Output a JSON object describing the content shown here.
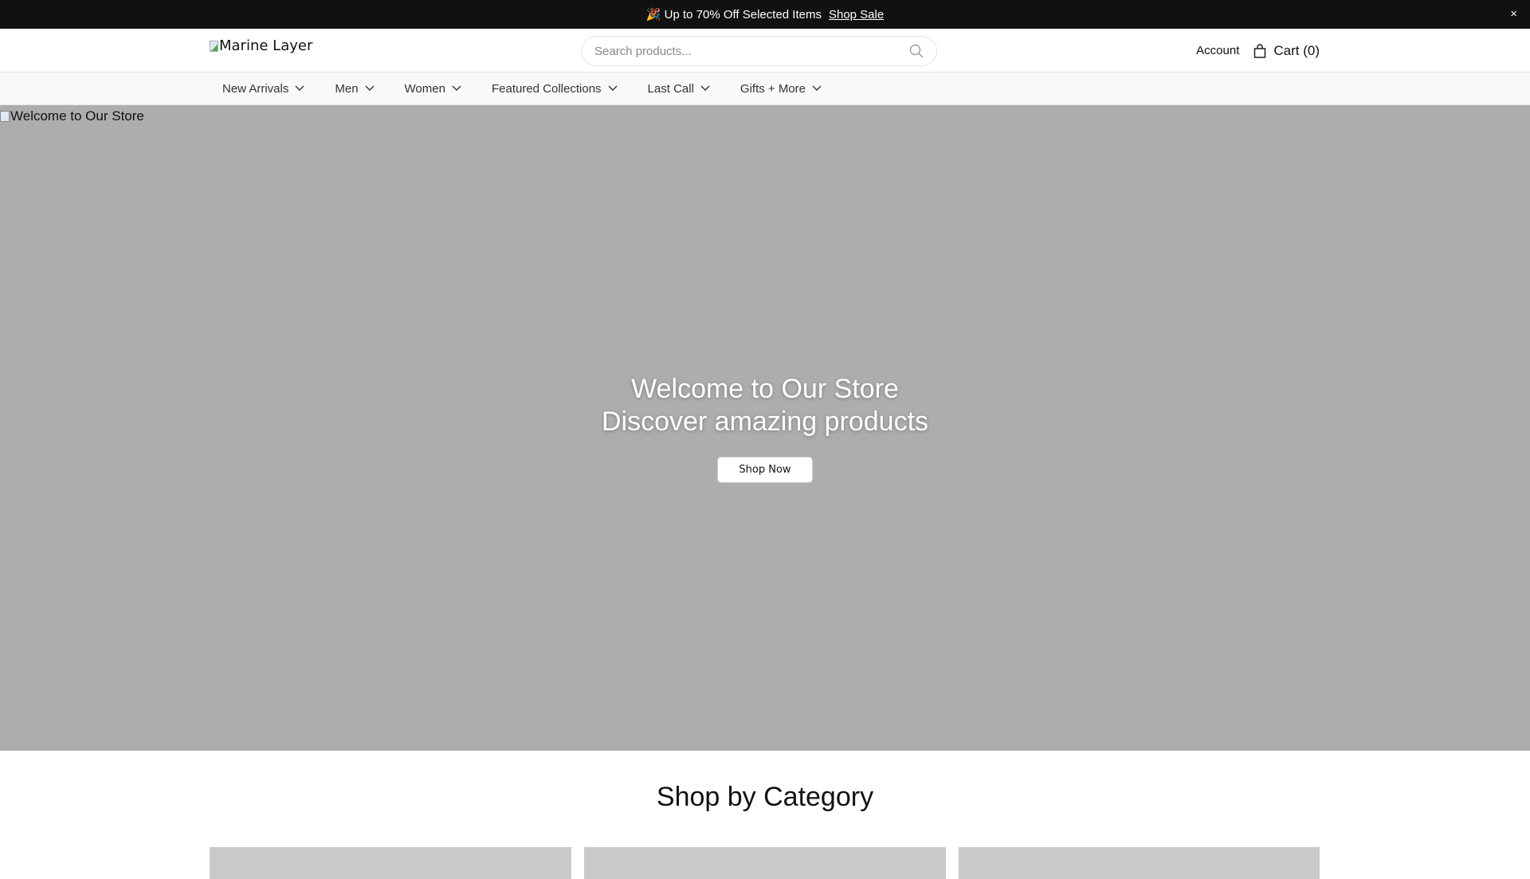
{
  "announcement": {
    "emoji": "🎉",
    "text": "Up to 70% Off Selected Items",
    "link": "Shop Sale",
    "close": "×"
  },
  "header": {
    "logo_alt": "Marine Layer",
    "search_placeholder": "Search products...",
    "account": "Account",
    "cart": "Cart (0)"
  },
  "nav": {
    "items": [
      {
        "label": "New Arrivals"
      },
      {
        "label": "Men"
      },
      {
        "label": "Women"
      },
      {
        "label": "Featured Collections"
      },
      {
        "label": "Last Call"
      },
      {
        "label": "Gifts + More"
      }
    ]
  },
  "hero": {
    "image_alt": "Welcome to Our Store",
    "title_line1": "Welcome to Our Store",
    "title_line2": "Discover amazing products",
    "button": "Shop Now"
  },
  "categories": {
    "title": "Shop by Category"
  }
}
